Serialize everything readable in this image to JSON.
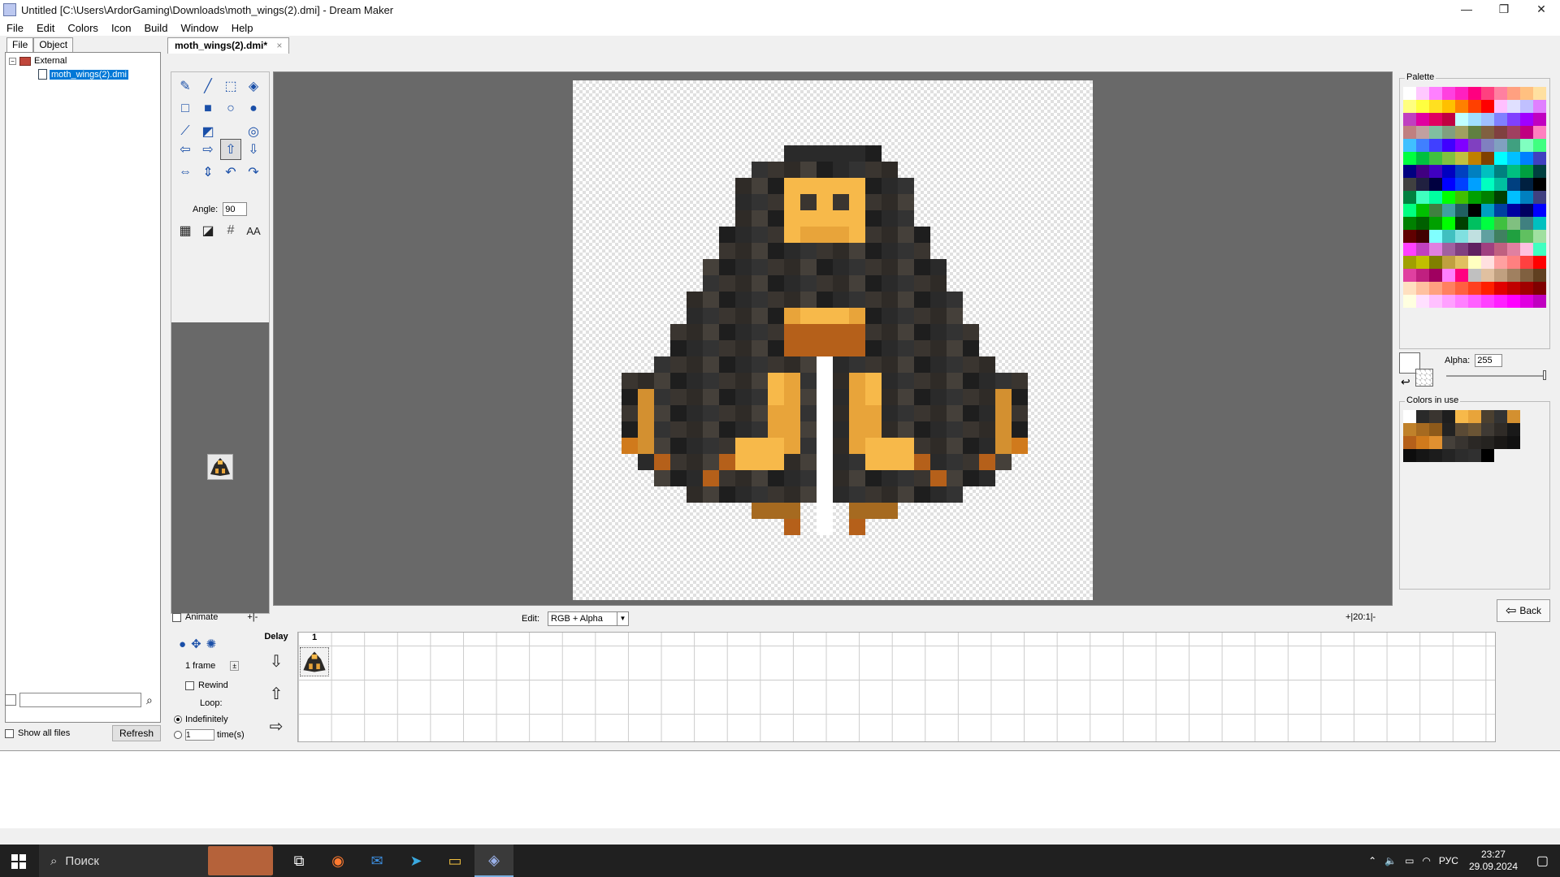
{
  "window": {
    "title": "Untitled [C:\\Users\\ArdorGaming\\Downloads\\moth_wings(2).dmi] - Dream Maker",
    "minimize": "—",
    "maximize": "❐",
    "close": "✕"
  },
  "menu": [
    "File",
    "Edit",
    "Colors",
    "Icon",
    "Build",
    "Window",
    "Help"
  ],
  "left": {
    "tabs": [
      "File",
      "Object"
    ],
    "tree": {
      "root": "External",
      "root_expander": "−",
      "child": "moth_wings(2).dmi"
    },
    "show_all_files": "Show all files",
    "refresh": "Refresh"
  },
  "document_tab": {
    "label": "moth_wings(2).dmi*",
    "close": "×"
  },
  "tools": {
    "angle_label": "Angle:",
    "angle_value": "90",
    "aa_label": "AA"
  },
  "edit_bar": {
    "animate": "Animate",
    "animate_btns": "+|-",
    "edit_label": "Edit:",
    "edit_value": "RGB + Alpha",
    "zoom": "+|20:1|-"
  },
  "frames": {
    "frame_count": "1 frame",
    "rewind": "Rewind",
    "loop": "Loop:",
    "indefinitely": "Indefinitely",
    "times_value": "1",
    "times_label": "time(s)",
    "delay_header": "Delay",
    "frame_header": "1"
  },
  "right": {
    "palette_label": "Palette",
    "alpha_label": "Alpha:",
    "alpha_value": "255",
    "colors_in_use_label": "Colors in use",
    "back_label": "Back"
  },
  "palette_colors": [
    "#ffffff",
    "#ffc8ff",
    "#ff80ff",
    "#ff40e0",
    "#ff20c0",
    "#ff0080",
    "#ff4080",
    "#ff80a0",
    "#ffa080",
    "#ffc080",
    "#ffe0a0",
    "#ffff80",
    "#ffff40",
    "#ffe020",
    "#ffc000",
    "#ff8000",
    "#ff4000",
    "#ff0000",
    "#ffc0ff",
    "#e0e0ff",
    "#c0c0ff",
    "#e080ff",
    "#c040c0",
    "#e000a0",
    "#e00060",
    "#c00040",
    "#c0ffff",
    "#a0e0ff",
    "#a0c0ff",
    "#8080ff",
    "#8040ff",
    "#a000ff",
    "#c000c0",
    "#c08080",
    "#c0a0a0",
    "#80c0a0",
    "#80a080",
    "#a0a060",
    "#608040",
    "#806040",
    "#804040",
    "#a04060",
    "#c00080",
    "#ff80c0",
    "#40c0ff",
    "#4080ff",
    "#4040ff",
    "#4000ff",
    "#8000ff",
    "#8040c0",
    "#8080c0",
    "#80a0c0",
    "#40a080",
    "#80ffc0",
    "#40ff80",
    "#00ff40",
    "#00c040",
    "#40c040",
    "#80c040",
    "#c0c040",
    "#c08000",
    "#804000",
    "#00ffff",
    "#00c0ff",
    "#0080ff",
    "#4040c0",
    "#000080",
    "#400080",
    "#4000c0",
    "#0000c0",
    "#0040c0",
    "#0080c0",
    "#00c0c0",
    "#008080",
    "#00c080",
    "#00a040",
    "#004040",
    "#404040",
    "#202040",
    "#000040",
    "#0000ff",
    "#0040ff",
    "#00a0ff",
    "#00ffc0",
    "#00c0a0",
    "#004080",
    "#002040",
    "#000000",
    "#008040",
    "#40ffc0",
    "#00ffa0",
    "#00ff00",
    "#40c000",
    "#00a000",
    "#008000",
    "#004000",
    "#00c0ff",
    "#0080c0",
    "#404080",
    "#00ff80",
    "#00c000",
    "#408040",
    "#40a0a0",
    "#206060",
    "#000000",
    "#00a0c0",
    "#0040a0",
    "#0000a0",
    "#000060",
    "#0000ff",
    "#008000",
    "#006000",
    "#00a000",
    "#00ff00",
    "#004000",
    "#00c060",
    "#00ff40",
    "#40c040",
    "#80c080",
    "#408080",
    "#00c0c0",
    "#600000",
    "#400000",
    "#80ffff",
    "#40c0c0",
    "#80e0e0",
    "#c0e0e0",
    "#60a0a0",
    "#408060",
    "#20a040",
    "#60c060",
    "#a0e0a0",
    "#ff40ff",
    "#c040c0",
    "#e080e0",
    "#a060a0",
    "#804080",
    "#602060",
    "#a04080",
    "#c06080",
    "#e080a0",
    "#ffc0e0",
    "#40ffc0",
    "#a0a000",
    "#c0c000",
    "#808000",
    "#c0a040",
    "#e0c060",
    "#ffffc0",
    "#ffe0e0",
    "#ffa0a0",
    "#ff8080",
    "#ff4040",
    "#ff0000",
    "#e040a0",
    "#c02080",
    "#a00060",
    "#ff80ff",
    "#ff0080",
    "#c0c0c0",
    "#e0c0a0",
    "#c0a080",
    "#a08060",
    "#806040",
    "#604020",
    "#ffe0c0",
    "#ffc0a0",
    "#ffa080",
    "#ff8060",
    "#ff6040",
    "#ff4020",
    "#ff2000",
    "#e00000",
    "#c00000",
    "#a00000",
    "#800000",
    "#ffffe0",
    "#ffe0ff",
    "#ffc0ff",
    "#ffa0ff",
    "#ff80ff",
    "#ff60ff",
    "#ff40ff",
    "#ff20ff",
    "#ff00ff",
    "#e000e0",
    "#c000c0"
  ],
  "colors_in_use": [
    "#ffffff",
    "#2a2a2a",
    "#3a3530",
    "#1e1e1e",
    "#f7b94a",
    "#e8a43a",
    "#4b4030",
    "#333333",
    "#d39030",
    "#c0812a",
    "#a66a20",
    "#8e5a1a",
    "#222222",
    "#5a4a35",
    "#6b5535",
    "#3f3a34",
    "#2f2b27",
    "#191919",
    "#b5601a",
    "#d07a1c",
    "#e09030",
    "#45403a",
    "#383430",
    "#2b2825",
    "#252320",
    "#1a1816",
    "#111111",
    "#0d0d0d",
    "#161616",
    "#1c1c1c",
    "#242424",
    "#2c2c2c",
    "#303030",
    "#000000"
  ],
  "taskbar": {
    "search_placeholder": "Поиск",
    "language": "РУС",
    "time": "23:27",
    "date": "29.09.2024"
  }
}
